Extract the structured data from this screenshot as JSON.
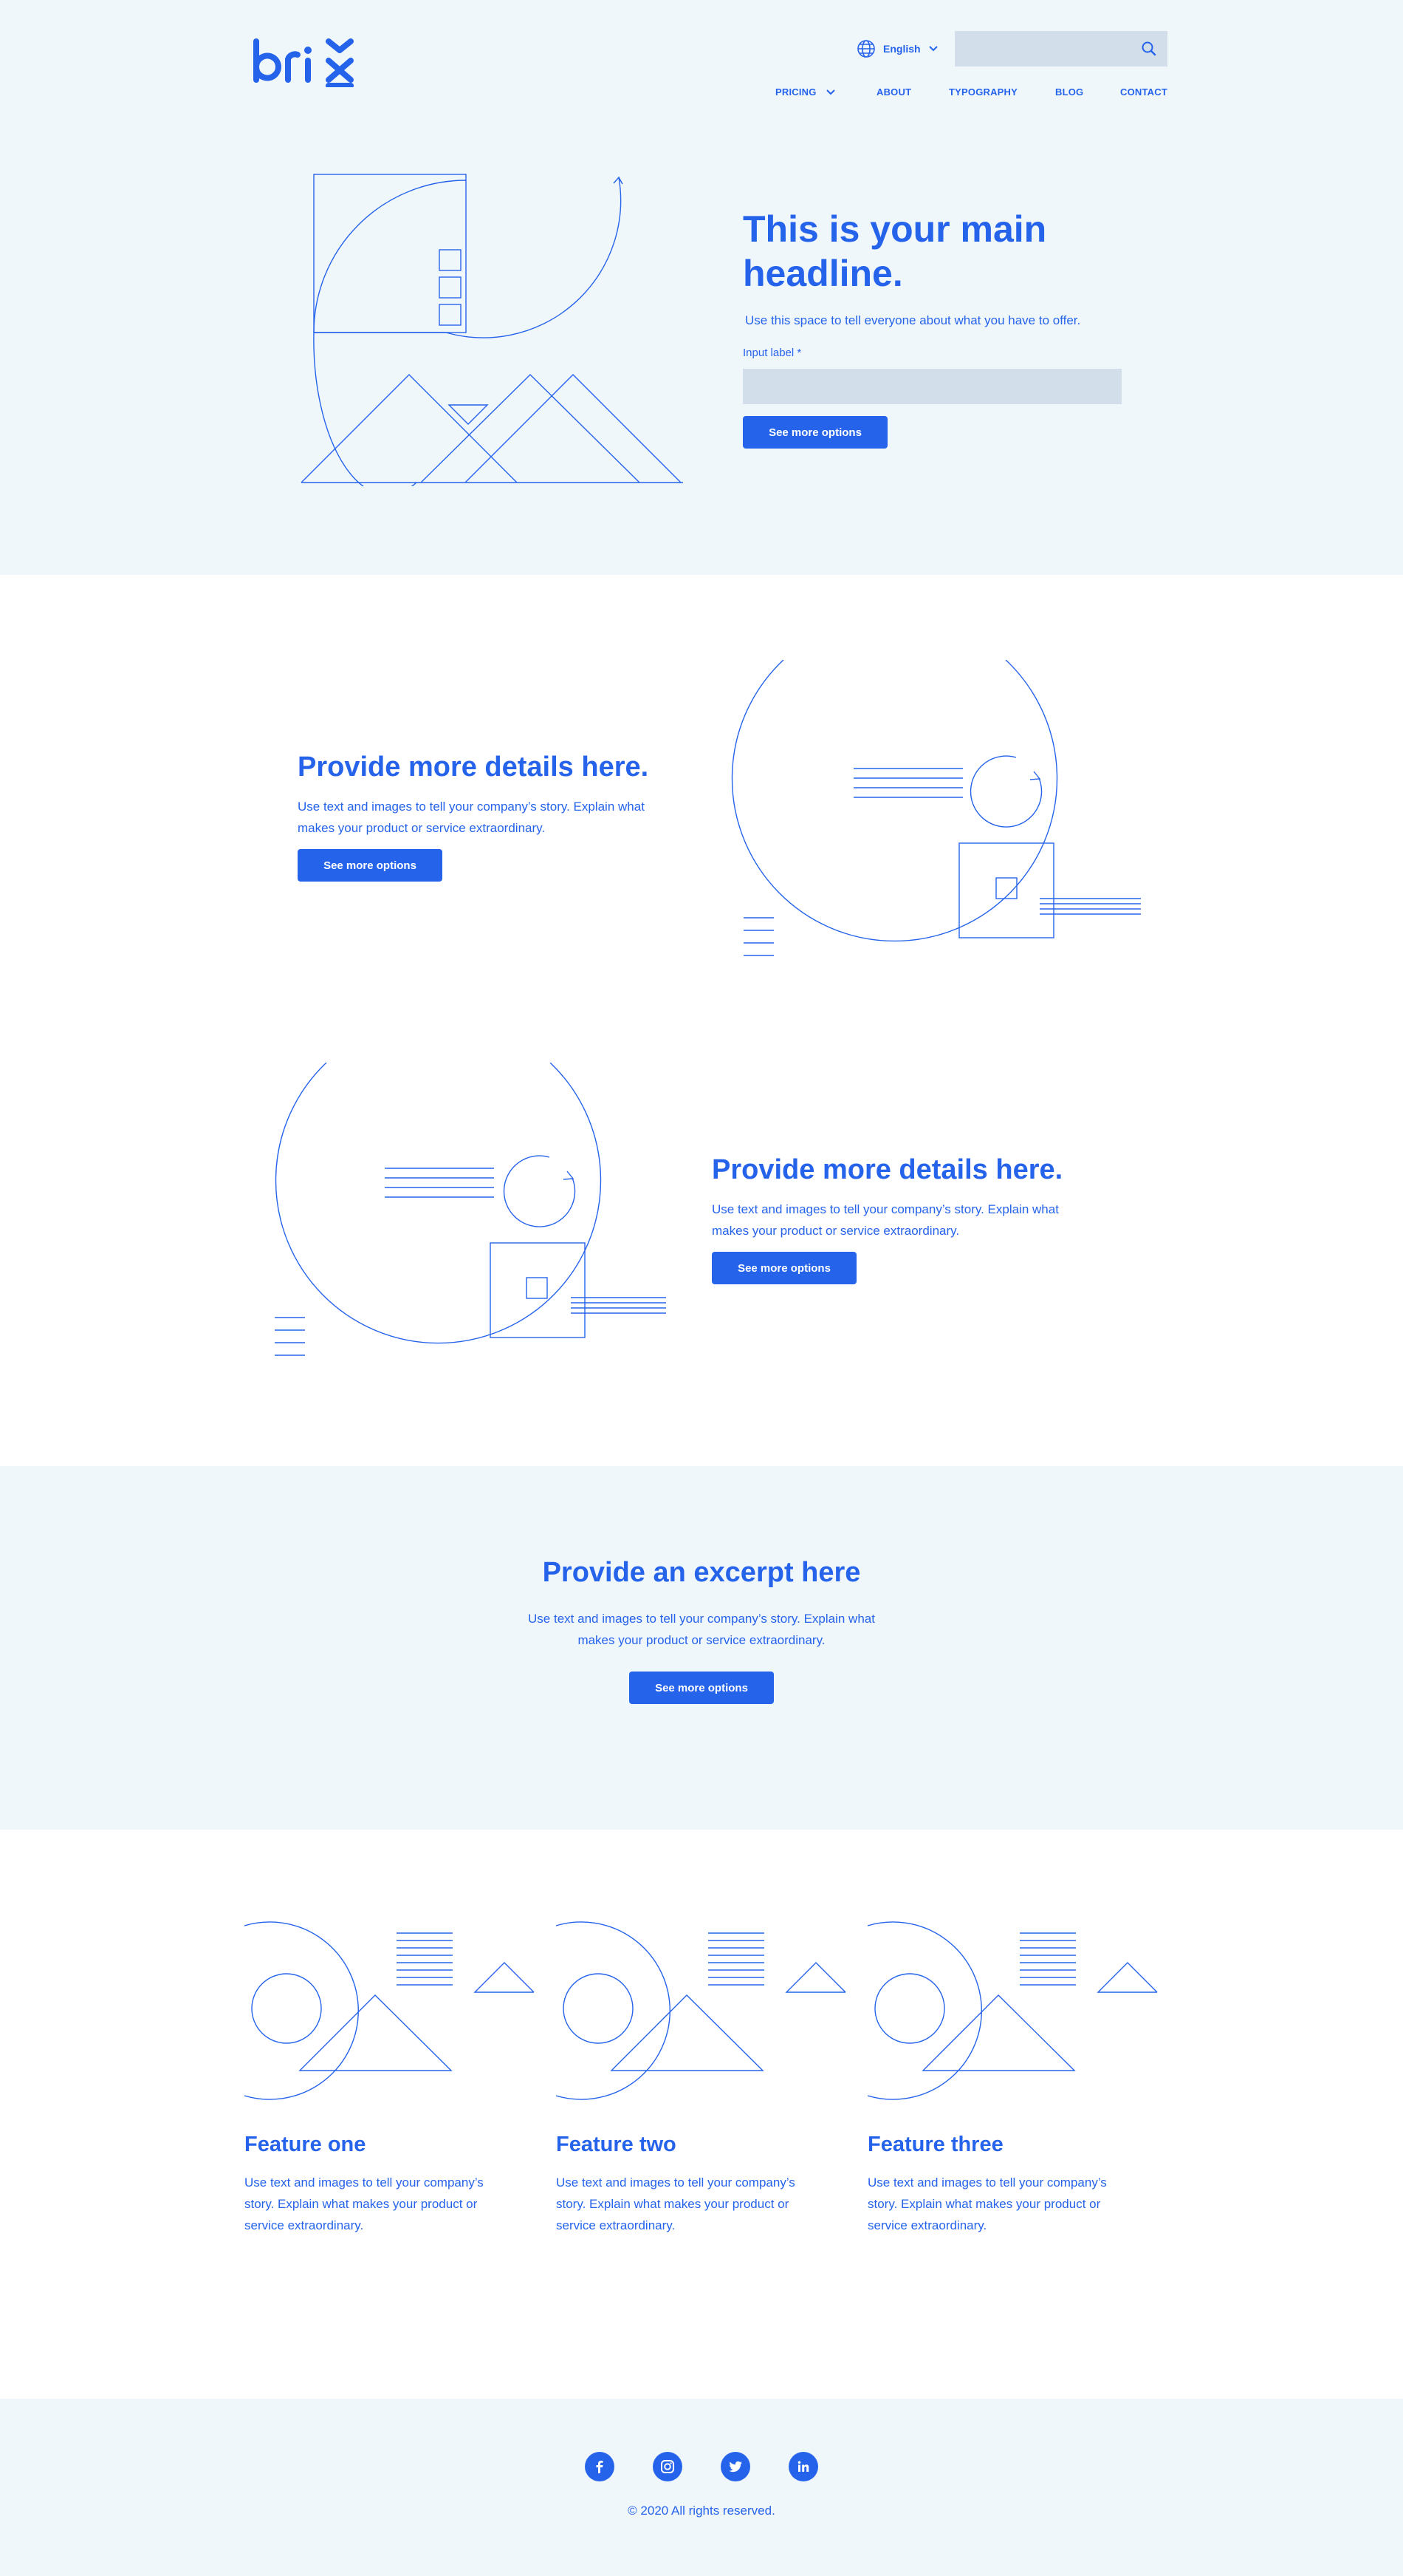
{
  "brand": {
    "logo_text": "brix"
  },
  "header": {
    "language": "English",
    "search_placeholder": "",
    "nav": [
      {
        "label": "PRICING"
      },
      {
        "label": "ABOUT"
      },
      {
        "label": "TYPOGRAPHY"
      },
      {
        "label": "BLOG"
      },
      {
        "label": "CONTACT"
      }
    ]
  },
  "hero": {
    "title": "This is your main headline.",
    "subtitle": "Use this space to tell everyone about what you have to offer.",
    "input_label": "Input label *",
    "input_value": "",
    "button": "See more options"
  },
  "details": [
    {
      "title": "Provide more details here.",
      "body": "Use text and images to tell your company’s story. Explain what makes your product or service extraordinary.",
      "button": "See more options"
    },
    {
      "title": "Provide more details here.",
      "body": "Use text and images to tell your company’s story. Explain what makes your product or service extraordinary.",
      "button": "See more options"
    }
  ],
  "excerpt": {
    "title": "Provide an excerpt here",
    "body": "Use text and images to tell your company’s story. Explain what makes your product or service extraordinary.",
    "button": "See more options"
  },
  "features": [
    {
      "title": "Feature one",
      "body": "Use text and images to tell your company’s story. Explain what makes your product or service extraordinary."
    },
    {
      "title": "Feature two",
      "body": "Use text and images to tell your company’s story. Explain what makes your product or service extraordinary."
    },
    {
      "title": "Feature three",
      "body": "Use text and images to tell your company’s story. Explain what makes your product or service extraordinary."
    }
  ],
  "footer": {
    "social": [
      "facebook-icon",
      "instagram-icon",
      "twitter-icon",
      "linkedin-icon"
    ],
    "copyright": "© 2020 All rights reserved."
  },
  "colors": {
    "accent": "#2563eb",
    "light_bg": "#f0f7fb",
    "field_bg": "#d3deeb"
  }
}
